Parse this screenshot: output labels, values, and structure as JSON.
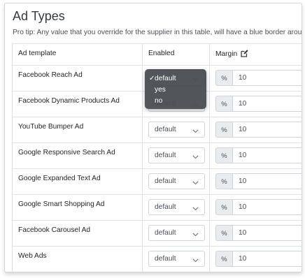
{
  "page": {
    "title": "Ad Types",
    "tip": "Pro tip: Any value that you override for the supplier in this table, will have a blue border around it."
  },
  "table": {
    "headers": {
      "ad_template": "Ad template",
      "enabled": "Enabled",
      "margin": "Margin"
    },
    "margin_unit": "%",
    "rows": [
      {
        "name": "Facebook Reach Ad",
        "enabled": "default",
        "margin": "10"
      },
      {
        "name": "Facebook Dynamic Products Ad",
        "enabled": "default",
        "margin": "10"
      },
      {
        "name": "YouTube Bumper Ad",
        "enabled": "default",
        "margin": "10"
      },
      {
        "name": "Google Responsive Search Ad",
        "enabled": "default",
        "margin": "10"
      },
      {
        "name": "Google Expanded Text Ad",
        "enabled": "default",
        "margin": "10"
      },
      {
        "name": "Google Smart Shopping Ad",
        "enabled": "default",
        "margin": "10"
      },
      {
        "name": "Facebook Carousel Ad",
        "enabled": "default",
        "margin": "10"
      },
      {
        "name": "Web Ads",
        "enabled": "default",
        "margin": "10"
      }
    ]
  },
  "dropdown": {
    "check": "✓",
    "options": [
      "default",
      "yes",
      "no"
    ],
    "selected": "default"
  },
  "icons": {
    "edit": "edit-icon",
    "chevron": "chevron-down-icon"
  },
  "colors": {
    "focus_border": "#80bdff",
    "dropdown_bg": "#4b4e52"
  }
}
